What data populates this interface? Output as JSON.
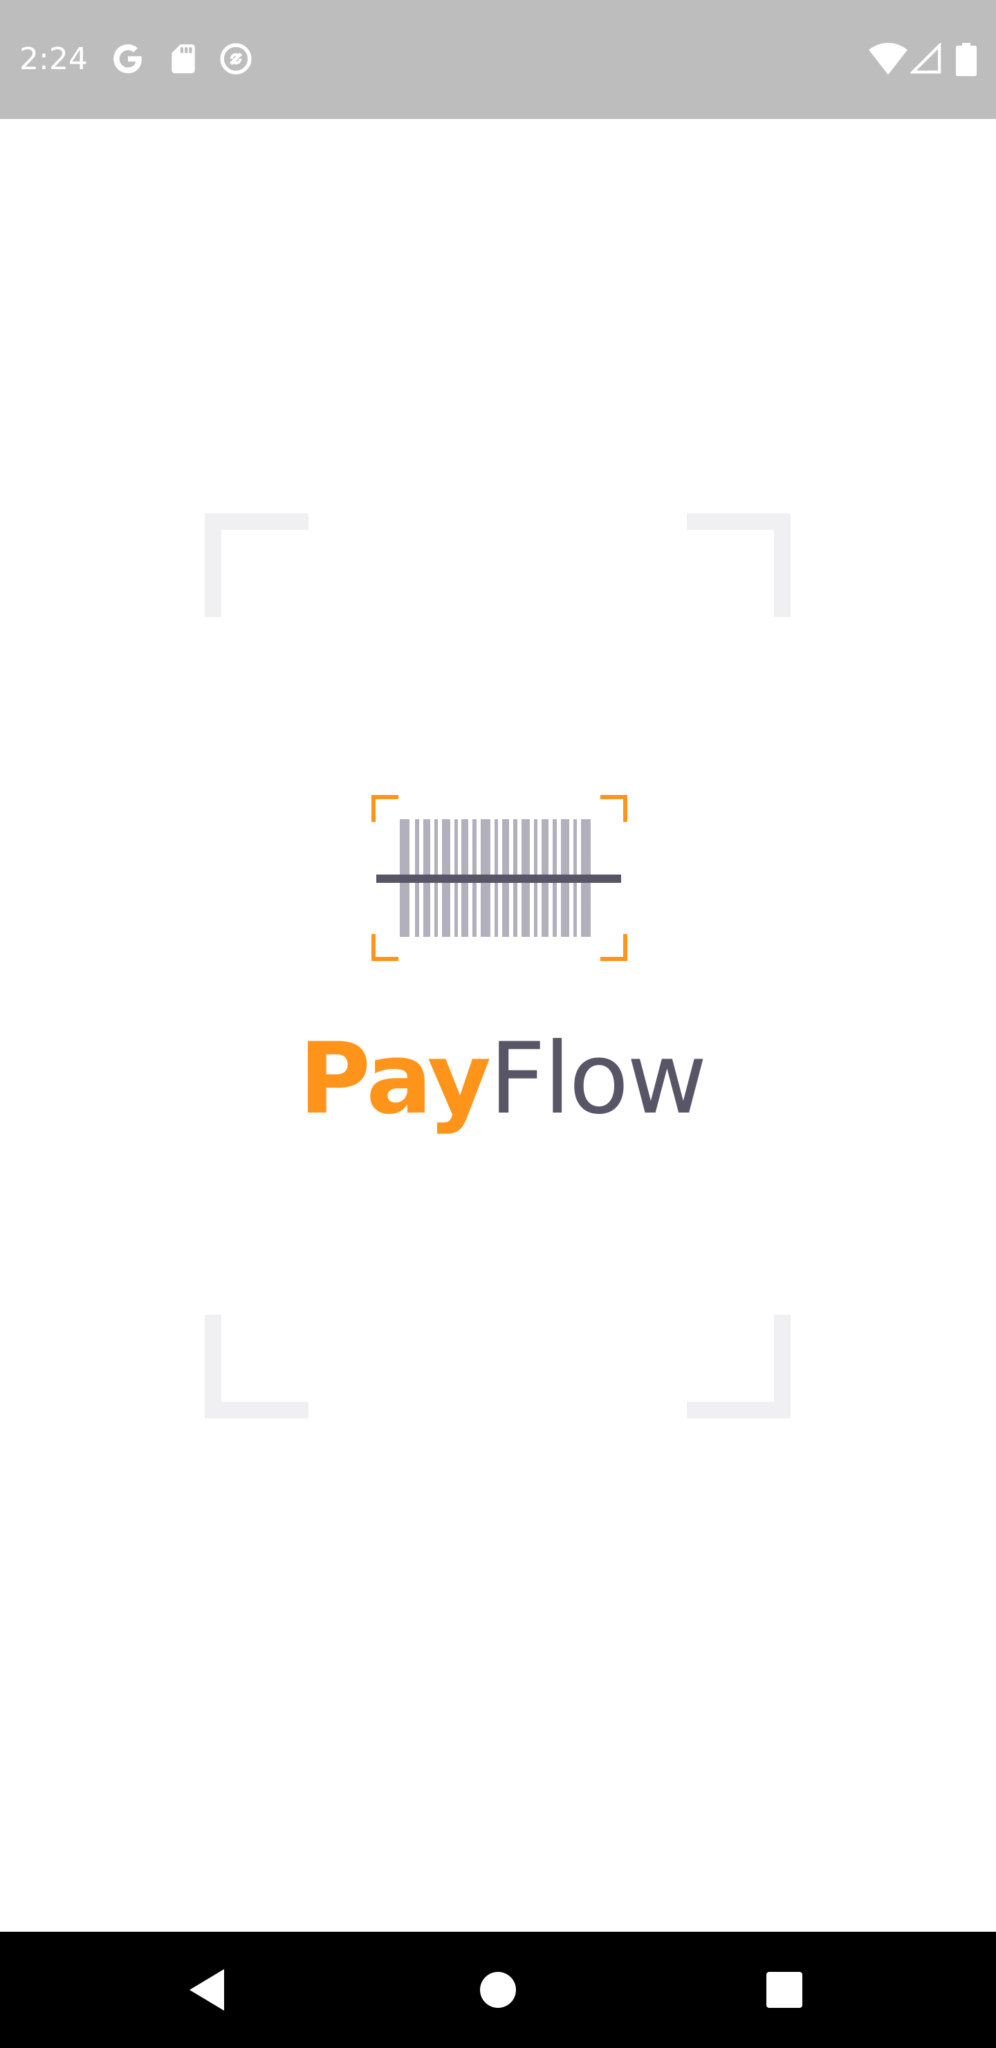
{
  "status_bar": {
    "time": "2:24",
    "background": "#bdbdbd",
    "left_icons": [
      "google-icon",
      "sd-card-icon",
      "no-sync-icon"
    ],
    "right_icons": [
      "wifi-icon",
      "cell-signal-icon",
      "battery-icon"
    ]
  },
  "splash": {
    "brand_part1": "Pay",
    "brand_part2": "Flow",
    "brand_color_primary": "#ff941a",
    "brand_color_secondary": "#585666",
    "barcode_bar_color": "#b1b0bc",
    "scan_line_color": "#585666",
    "frame_corner_color": "#f0f0f3"
  },
  "nav_bar": {
    "buttons": [
      "back-icon",
      "home-icon",
      "recents-icon"
    ],
    "background": "#000000"
  }
}
